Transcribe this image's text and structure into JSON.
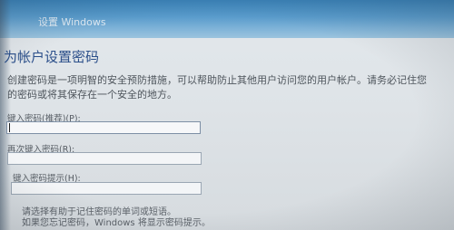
{
  "window": {
    "title": "设置 Windows"
  },
  "page": {
    "heading": "为帐户设置密码",
    "description_line1": "创建密码是一项明智的安全预防措施，可以帮助防止其他用户访问您的用户帐户。请务必记住您",
    "description_line2": "的密码或将其保存在一个安全的地方。"
  },
  "form": {
    "password_label": "键入密码(推荐)(P):",
    "password_value": "",
    "confirm_label": "再次键入密码(R):",
    "confirm_value": "",
    "hint_label": "键入密码提示(H):",
    "hint_value": ""
  },
  "hint_text": {
    "line1": "请选择有助于记住密码的单词或短语。",
    "line2": "如果您忘记密码，Windows 将显示密码提示。"
  }
}
